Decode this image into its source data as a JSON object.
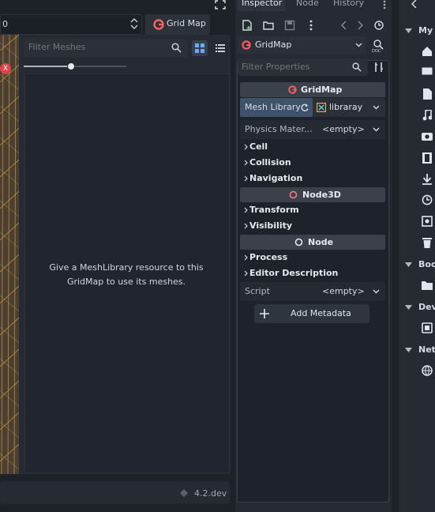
{
  "viewport": {
    "number_value": "0",
    "gridmap_label": "Grid Map",
    "close_marker": "X"
  },
  "meshes": {
    "filter_placeholder": "Filter Meshes",
    "message": "Give a MeshLibrary resource to this GridMap to use its meshes.",
    "zoom": 0.45
  },
  "status": {
    "version": "4.2.dev"
  },
  "inspector": {
    "tabs": [
      "Inspector",
      "Node",
      "History"
    ],
    "node_name": "GridMap",
    "filter_placeholder": "Filter Properties",
    "class_header": "GridMap",
    "mesh_library_label": "Mesh Library",
    "mesh_library_value": "libraray",
    "physics_label": "Physics Mater...",
    "physics_value": "<empty>",
    "groups": [
      "Cell",
      "Collision",
      "Navigation"
    ],
    "node3d_header": "Node3D",
    "node3d_groups": [
      "Transform",
      "Visibility"
    ],
    "node_header": "Node",
    "node_groups": [
      "Process",
      "Editor Description"
    ],
    "script_label": "Script",
    "script_value": "<empty>",
    "add_metadata_label": "Add Metadata"
  },
  "filesystem": {
    "items": [
      "My",
      "Boo",
      "Dev",
      "Net"
    ]
  },
  "colors": {
    "accent": "#ff5f5f",
    "grid_line": "#e0a53a",
    "viewport_bg": "#4a3f33"
  }
}
